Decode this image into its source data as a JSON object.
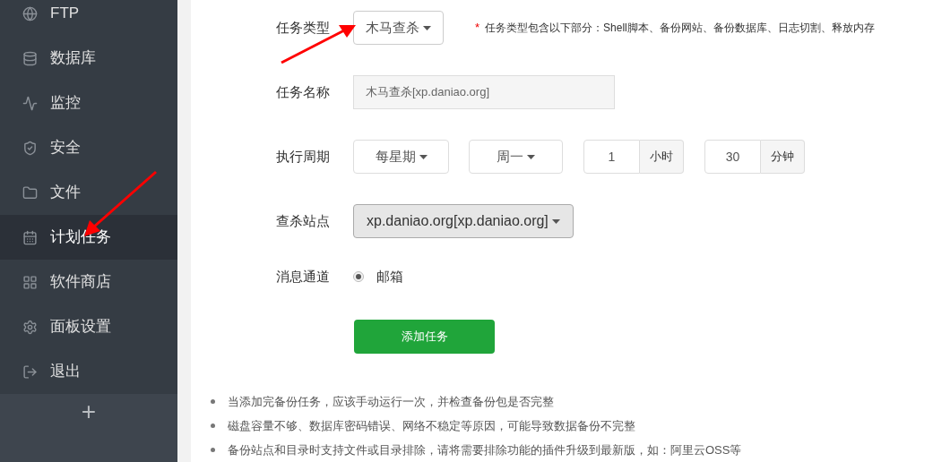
{
  "sidebar": {
    "items": [
      {
        "label": "FTP",
        "selected": false
      },
      {
        "label": "数据库",
        "selected": false
      },
      {
        "label": "监控",
        "selected": false
      },
      {
        "label": "安全",
        "selected": false
      },
      {
        "label": "文件",
        "selected": false
      },
      {
        "label": "计划任务",
        "selected": true
      },
      {
        "label": "软件商店",
        "selected": false
      },
      {
        "label": "面板设置",
        "selected": false
      },
      {
        "label": "退出",
        "selected": false
      }
    ],
    "add_button": "+"
  },
  "form": {
    "task_type": {
      "label": "任务类型",
      "value": "木马查杀",
      "hint_mark": "*",
      "hint": "任务类型包含以下部分：Shell脚本、备份网站、备份数据库、日志切割、释放内存"
    },
    "task_name": {
      "label": "任务名称",
      "value": "木马查杀[xp.daniao.org]"
    },
    "cycle": {
      "label": "执行周期",
      "period": "每星期",
      "weekday": "周一",
      "hour": "1",
      "hour_unit": "小时",
      "minute": "30",
      "minute_unit": "分钟"
    },
    "site": {
      "label": "查杀站点",
      "value": "xp.daniao.org[xp.daniao.org]"
    },
    "channel": {
      "label": "消息通道",
      "options": [
        {
          "label": "邮箱",
          "selected": true
        }
      ]
    },
    "submit": "添加任务"
  },
  "notes": [
    "当添加完备份任务，应该手动运行一次，并检查备份包是否完整",
    "磁盘容量不够、数据库密码错误、网络不稳定等原因，可能导致数据备份不完整",
    "备份站点和目录时支持文件或目录排除，请将需要排除功能的插件升级到最新版，如：阿里云OSS等"
  ]
}
